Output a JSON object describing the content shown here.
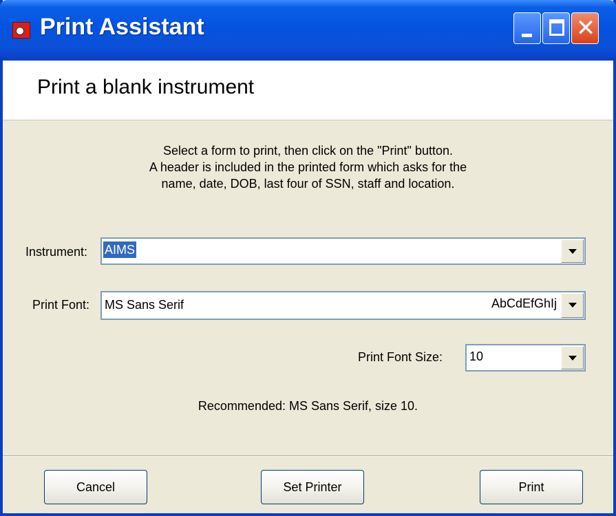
{
  "window": {
    "title": "Print Assistant",
    "controls": {
      "minimize": "",
      "maximize": "",
      "close": "✕"
    }
  },
  "header": {
    "title": "Print a blank instrument"
  },
  "instructions": [
    "Select a form to print, then click on the \"Print\" button.",
    "A header is included in the printed form which asks for the",
    "name, date, DOB, last four of SSN, staff and location."
  ],
  "instrument": {
    "label": "Instrument:",
    "value": "AIMS"
  },
  "print_font": {
    "label": "Print Font:",
    "value": "MS Sans Serif",
    "sample": "AbCdEfGhIj"
  },
  "font_size": {
    "label": "Print Font Size:",
    "value": "10"
  },
  "recommendation": "Recommended: MS Sans Serif, size 10.",
  "buttons": {
    "cancel": "Cancel",
    "set_printer": "Set Printer",
    "print": "Print"
  },
  "icons": [
    "app-icon",
    "dropdown-arrow-icon"
  ],
  "colors": {
    "title_bar": "#0553e0",
    "selection": "#316ac5",
    "dialog_bg": "#ece9d8",
    "close_button": "#d9411a"
  }
}
